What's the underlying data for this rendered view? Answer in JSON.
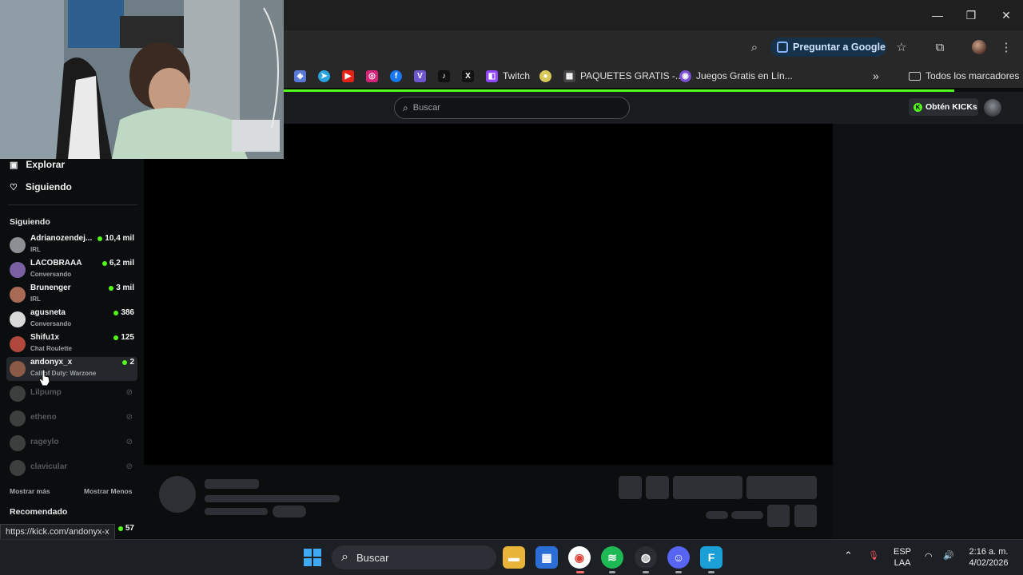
{
  "window": {
    "minimize": "—",
    "restore": "❐",
    "close": "✕"
  },
  "toolbar": {
    "ask_google": "Preguntar a Google"
  },
  "bookmarks": {
    "twitch": "Twitch",
    "paquetes": "PAQUETES GRATIS -...",
    "juegos": "Juegos Gratis en Lín...",
    "all": "Todos los marcadores"
  },
  "header": {
    "search_placeholder": "Buscar",
    "get_kicks": "Obtén KICKs"
  },
  "sidebar": {
    "nav": [
      {
        "label": "Explorar",
        "icon": "explore-icon"
      },
      {
        "label": "Siguiendo",
        "icon": "heart-icon"
      }
    ],
    "following_label": "Siguiendo",
    "following": [
      {
        "name": "Adrianozendej...",
        "category": "IRL",
        "viewers": "10,4 mil",
        "color": "#8c8f93"
      },
      {
        "name": "LACOBRAAA",
        "category": "Conversando",
        "viewers": "6,2 mil",
        "color": "#7b5fa3"
      },
      {
        "name": "Brunenger",
        "category": "IRL",
        "viewers": "3 mil",
        "color": "#a86a55"
      },
      {
        "name": "agusneta",
        "category": "Conversando",
        "viewers": "386",
        "color": "#d9d9d9"
      },
      {
        "name": "Shifu1x",
        "category": "Chat Roulette",
        "viewers": "125",
        "color": "#b0483e"
      },
      {
        "name": "andonyx_x",
        "category": "Call of Duty: Warzone",
        "viewers": "2",
        "color": "#8a5a46"
      }
    ],
    "offline": [
      "Lilpump",
      "etheno",
      "rageylo",
      "clavicular"
    ],
    "show_more": "Mostrar más",
    "show_less": "Mostrar Menos",
    "recommended_label": "Recomendado",
    "recommended_viewers": "57"
  },
  "status_url": "https://kick.com/andonyx-x",
  "taskbar": {
    "search": "Buscar",
    "lang1": "ESP",
    "lang2": "LAA",
    "time": "2:16 a. m.",
    "date": "4/02/2026"
  }
}
